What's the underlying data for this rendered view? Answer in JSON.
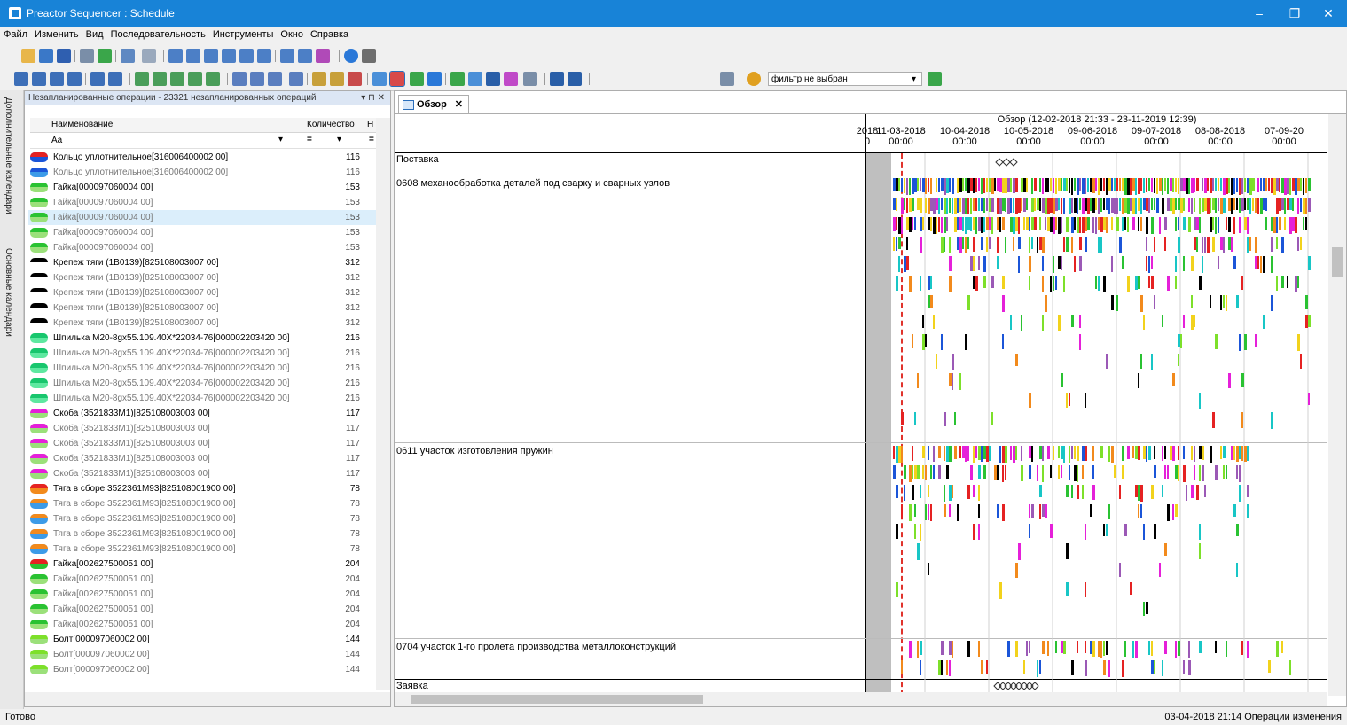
{
  "window": {
    "title": "Preactor Sequencer : Schedule",
    "minimize": "–",
    "restore": "❐",
    "close": "✕"
  },
  "menu": [
    "Файл",
    "Изменить",
    "Вид",
    "Последовательность",
    "Инструменты",
    "Окно",
    "Справка"
  ],
  "toolbar": {
    "filter_value": "фильтр не выбран"
  },
  "side_tabs": [
    "Дополнительные календари",
    "Основные календари"
  ],
  "panel": {
    "title": "Незапланированные операции - 23321 незапланированных операций",
    "col_name": "Наименование",
    "col_qty": "Количество",
    "col_extra": "Н",
    "filter_name": "Aa",
    "filter_eq": "=",
    "rows": [
      {
        "name": "Кольцо уплотнительное[316006400002 00]",
        "qty": "116",
        "c1": "#e52222",
        "c2": "#1b55d8",
        "bold": true
      },
      {
        "name": "Кольцо уплотнительное[316006400002 00]",
        "qty": "116",
        "c1": "#1b55d8",
        "c2": "#3c9be8",
        "bold": false
      },
      {
        "name": "Гайка[000097060004 00]",
        "qty": "153",
        "c1": "#2ac232",
        "c2": "#9be07a",
        "bold": true
      },
      {
        "name": "Гайка[000097060004 00]",
        "qty": "153",
        "c1": "#2ac232",
        "c2": "#9be07a",
        "bold": false
      },
      {
        "name": "Гайка[000097060004 00]",
        "qty": "153",
        "c1": "#2ac232",
        "c2": "#9be07a",
        "bold": false,
        "selected": true
      },
      {
        "name": "Гайка[000097060004 00]",
        "qty": "153",
        "c1": "#2ac232",
        "c2": "#9be07a",
        "bold": false
      },
      {
        "name": "Гайка[000097060004 00]",
        "qty": "153",
        "c1": "#2ac232",
        "c2": "#9be07a",
        "bold": false
      },
      {
        "name": "Крепеж тяги (1В0139)[825108003007 00]",
        "qty": "312",
        "c1": "#000000",
        "c2": "#ffffff",
        "bold": true
      },
      {
        "name": "Крепеж тяги (1В0139)[825108003007 00]",
        "qty": "312",
        "c1": "#000000",
        "c2": "#ffffff",
        "bold": false
      },
      {
        "name": "Крепеж тяги (1В0139)[825108003007 00]",
        "qty": "312",
        "c1": "#000000",
        "c2": "#ffffff",
        "bold": false
      },
      {
        "name": "Крепеж тяги (1В0139)[825108003007 00]",
        "qty": "312",
        "c1": "#000000",
        "c2": "#ffffff",
        "bold": false
      },
      {
        "name": "Крепеж тяги (1В0139)[825108003007 00]",
        "qty": "312",
        "c1": "#000000",
        "c2": "#ffffff",
        "bold": false
      },
      {
        "name": "Шпилька М20-8gx55.109.40Х*22034-76[000002203420 00]",
        "qty": "216",
        "c1": "#18c66d",
        "c2": "#5ee8a0",
        "bold": true
      },
      {
        "name": "Шпилька М20-8gx55.109.40Х*22034-76[000002203420 00]",
        "qty": "216",
        "c1": "#18c66d",
        "c2": "#5ee8a0",
        "bold": false
      },
      {
        "name": "Шпилька М20-8gx55.109.40Х*22034-76[000002203420 00]",
        "qty": "216",
        "c1": "#18c66d",
        "c2": "#5ee8a0",
        "bold": false
      },
      {
        "name": "Шпилька М20-8gx55.109.40Х*22034-76[000002203420 00]",
        "qty": "216",
        "c1": "#18c66d",
        "c2": "#5ee8a0",
        "bold": false
      },
      {
        "name": "Шпилька М20-8gx55.109.40Х*22034-76[000002203420 00]",
        "qty": "216",
        "c1": "#18c66d",
        "c2": "#5ee8a0",
        "bold": false
      },
      {
        "name": "Скоба (3521833М1)[825108003003 00]",
        "qty": "117",
        "c1": "#e520d9",
        "c2": "#9be07a",
        "bold": true
      },
      {
        "name": "Скоба (3521833М1)[825108003003 00]",
        "qty": "117",
        "c1": "#e520d9",
        "c2": "#9be07a",
        "bold": false
      },
      {
        "name": "Скоба (3521833М1)[825108003003 00]",
        "qty": "117",
        "c1": "#e520d9",
        "c2": "#9be07a",
        "bold": false
      },
      {
        "name": "Скоба (3521833М1)[825108003003 00]",
        "qty": "117",
        "c1": "#e520d9",
        "c2": "#9be07a",
        "bold": false
      },
      {
        "name": "Скоба (3521833М1)[825108003003 00]",
        "qty": "117",
        "c1": "#e520d9",
        "c2": "#9be07a",
        "bold": false
      },
      {
        "name": "Тяга в сборе 3522361М93[825108001900 00]",
        "qty": "78",
        "c1": "#e52222",
        "c2": "#f28a1c",
        "bold": true
      },
      {
        "name": "Тяга в сборе 3522361М93[825108001900 00]",
        "qty": "78",
        "c1": "#f28a1c",
        "c2": "#3c9be8",
        "bold": false
      },
      {
        "name": "Тяга в сборе 3522361М93[825108001900 00]",
        "qty": "78",
        "c1": "#f28a1c",
        "c2": "#3c9be8",
        "bold": false
      },
      {
        "name": "Тяга в сборе 3522361М93[825108001900 00]",
        "qty": "78",
        "c1": "#f28a1c",
        "c2": "#3c9be8",
        "bold": false
      },
      {
        "name": "Тяга в сборе 3522361М93[825108001900 00]",
        "qty": "78",
        "c1": "#f28a1c",
        "c2": "#3c9be8",
        "bold": false
      },
      {
        "name": "Гайка[002627500051 00]",
        "qty": "204",
        "c1": "#e52222",
        "c2": "#2ac232",
        "bold": true
      },
      {
        "name": "Гайка[002627500051 00]",
        "qty": "204",
        "c1": "#2ac232",
        "c2": "#9be07a",
        "bold": false
      },
      {
        "name": "Гайка[002627500051 00]",
        "qty": "204",
        "c1": "#2ac232",
        "c2": "#9be07a",
        "bold": false
      },
      {
        "name": "Гайка[002627500051 00]",
        "qty": "204",
        "c1": "#2ac232",
        "c2": "#9be07a",
        "bold": false
      },
      {
        "name": "Гайка[002627500051 00]",
        "qty": "204",
        "c1": "#2ac232",
        "c2": "#9be07a",
        "bold": false
      },
      {
        "name": "Болт[000097060002 00]",
        "qty": "144",
        "c1": "#7de02a",
        "c2": "#9be07a",
        "bold": true
      },
      {
        "name": "Болт[000097060002 00]",
        "qty": "144",
        "c1": "#7de02a",
        "c2": "#9be07a",
        "bold": false
      },
      {
        "name": "Болт[000097060002 00]",
        "qty": "144",
        "c1": "#7de02a",
        "c2": "#9be07a",
        "bold": false
      }
    ]
  },
  "doc": {
    "tab_label": "Обзор",
    "tab_close": "✕",
    "overview_title": "Обзор  (12-02-2018 21:33 - 23-11-2019 12:39)",
    "dates": [
      {
        "d": "2018",
        "t": "0"
      },
      {
        "d": "11-03-2018",
        "t": "00:00"
      },
      {
        "d": "10-04-2018",
        "t": "00:00"
      },
      {
        "d": "10-05-2018",
        "t": "00:00"
      },
      {
        "d": "09-06-2018",
        "t": "00:00"
      },
      {
        "d": "09-07-2018",
        "t": "00:00"
      },
      {
        "d": "08-08-2018",
        "t": "00:00"
      },
      {
        "d": "07-09-20",
        "t": "00:00"
      }
    ],
    "resources": [
      "Поставка",
      "0608 механообработка деталей под сварку и сварных узлов",
      "0611 участок изготовления пружин",
      "0704 участок 1-го пролета производства металлоконструкций",
      "Заявка"
    ]
  },
  "status": {
    "left": "Готово",
    "right": "03-04-2018 21:14   Операции изменения"
  },
  "colors": {
    "titlebar": "#1883d7",
    "selection": "#dbeefb",
    "now_line": "#e0332c"
  }
}
